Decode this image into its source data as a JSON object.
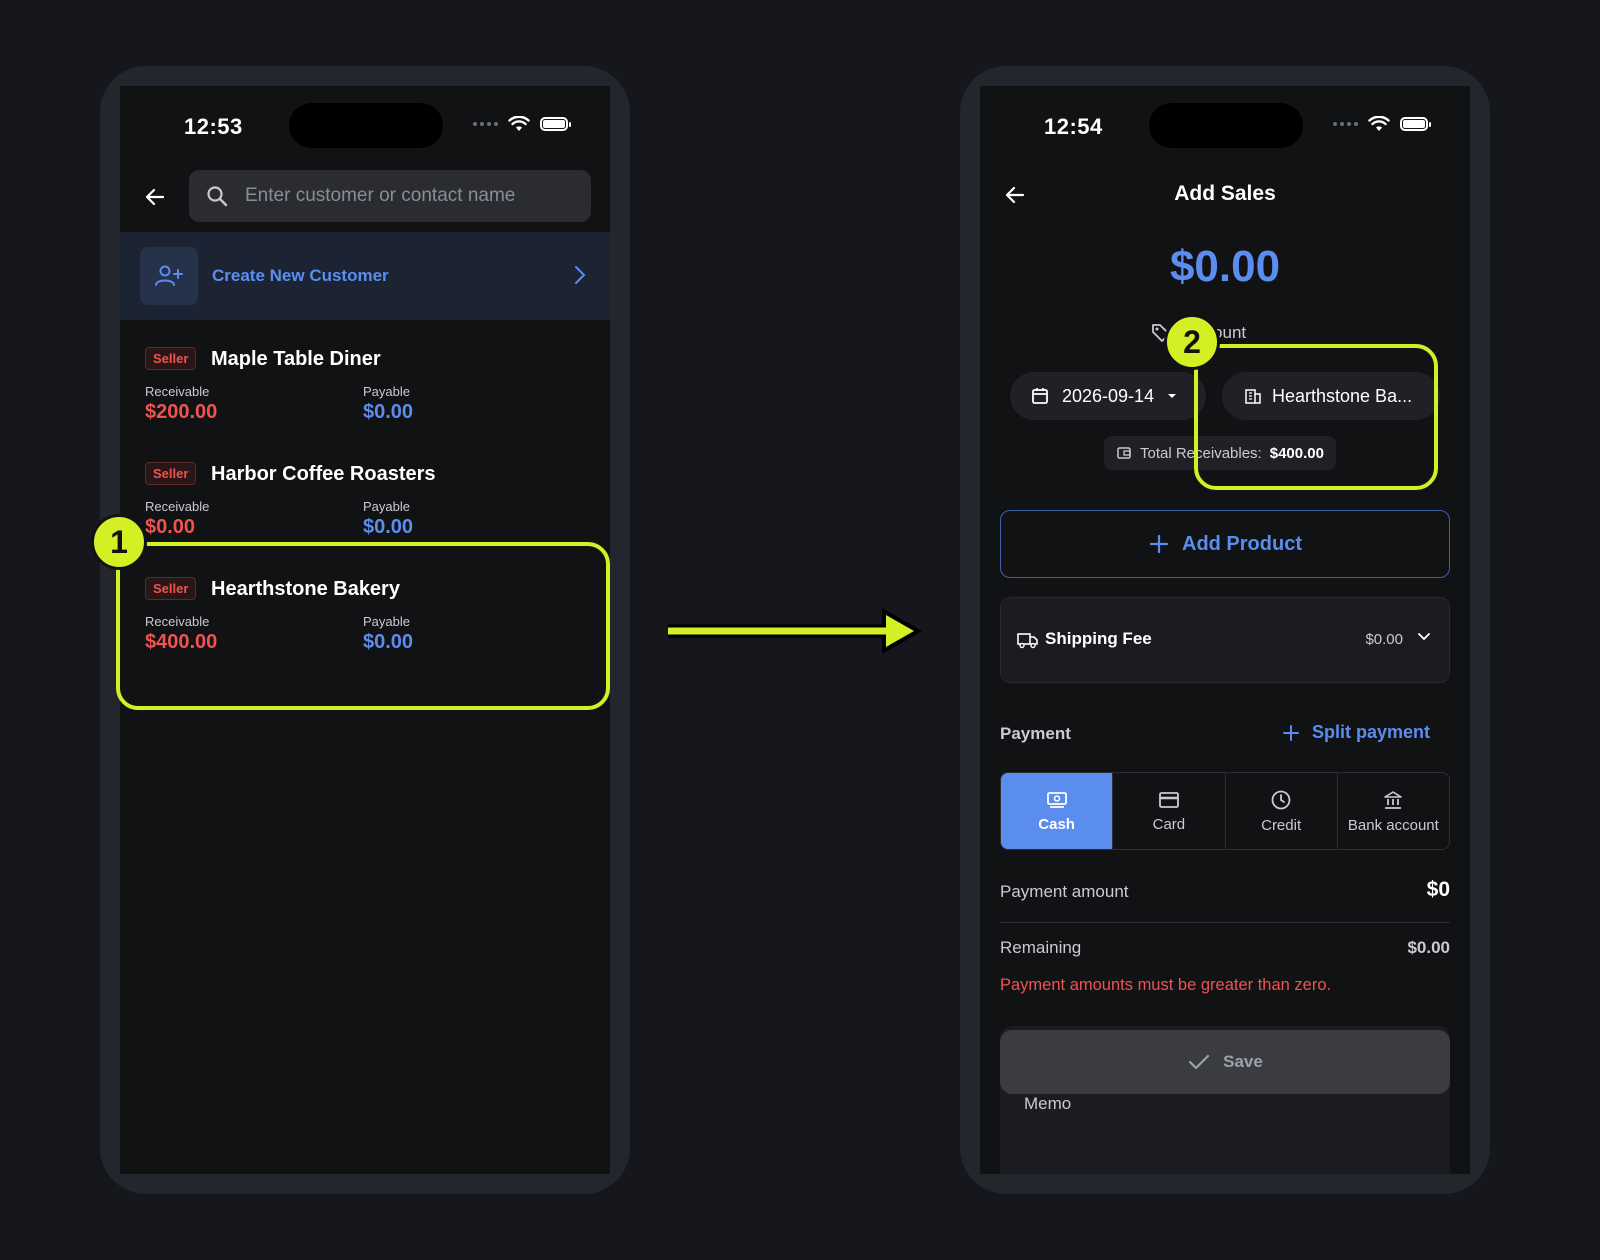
{
  "left_screen": {
    "status": {
      "time": "12:53"
    },
    "search": {
      "placeholder": "Enter customer or contact name"
    },
    "create_label": "Create New Customer",
    "customers": [
      {
        "badge": "Seller",
        "name": "Maple Table Diner",
        "receivable_label": "Receivable",
        "receivable": "$200.00",
        "payable_label": "Payable",
        "payable": "$0.00"
      },
      {
        "badge": "Seller",
        "name": "Harbor Coffee Roasters",
        "receivable_label": "Receivable",
        "receivable": "$0.00",
        "payable_label": "Payable",
        "payable": "$0.00"
      },
      {
        "badge": "Seller",
        "name": "Hearthstone Bakery",
        "receivable_label": "Receivable",
        "receivable": "$400.00",
        "payable_label": "Payable",
        "payable": "$0.00"
      }
    ]
  },
  "right_screen": {
    "status": {
      "time": "12:54"
    },
    "title": "Add Sales",
    "amount": "$0.00",
    "discount_label": "Discount",
    "date": "2026-09-14",
    "customer": "Hearthstone Ba...",
    "total_receivables_label": "Total Receivables:",
    "total_receivables": "$400.00",
    "add_product": "Add Product",
    "shipping": {
      "label": "Shipping Fee",
      "value": "$0.00"
    },
    "payment_label": "Payment",
    "split_payment": "Split payment",
    "methods": [
      {
        "label": "Cash",
        "icon": "cash-icon",
        "active": true
      },
      {
        "label": "Card",
        "icon": "card-icon",
        "active": false
      },
      {
        "label": "Credit",
        "icon": "clock-icon",
        "active": false
      },
      {
        "label": "Bank account",
        "icon": "bank-icon",
        "active": false
      }
    ],
    "payment_amount_label": "Payment amount",
    "payment_amount": "$0",
    "remaining_label": "Remaining",
    "remaining": "$0.00",
    "error": "Payment amounts must be greater than zero.",
    "save": "Save",
    "memo_label": "Memo"
  },
  "annotations": {
    "step1": "1",
    "step2": "2"
  },
  "colors": {
    "accent": "#5b8def",
    "highlight": "#d4f024",
    "error": "#ef5350",
    "background": "#15171c"
  }
}
